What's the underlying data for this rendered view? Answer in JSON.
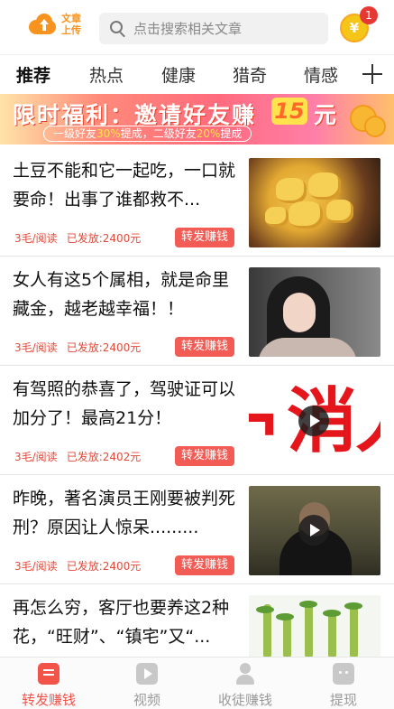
{
  "header": {
    "upload_label": "文章上传",
    "search_placeholder": "点击搜索相关文章",
    "coin_symbol": "¥",
    "notification_count": "1"
  },
  "tabs": [
    {
      "label": "推荐",
      "active": true
    },
    {
      "label": "热点"
    },
    {
      "label": "健康"
    },
    {
      "label": "猎奇"
    },
    {
      "label": "情感"
    }
  ],
  "banner": {
    "title": "限时福利：邀请好友赚",
    "amount": "15",
    "unit": "元",
    "sub_prefix": "一级好友",
    "sub_rate1": "30%",
    "sub_mid": "提成，二级好友",
    "sub_rate2": "20%",
    "sub_suffix": "提成"
  },
  "articles": [
    {
      "title": "土豆不能和它一起吃，一口就要命！出事了谁都救不...",
      "rate": "3毛/阅读",
      "paid": "已发放:2400元",
      "share": "转发赚钱",
      "thumb": "potato-dish",
      "video": false
    },
    {
      "title": "女人有这5个属相，就是命里藏金，越老越幸福！！",
      "rate": "3毛/阅读",
      "paid": "已发放:2400元",
      "share": "转发赚钱",
      "thumb": "woman-portrait",
      "video": false
    },
    {
      "title": "有驾照的恭喜了，驾驶证可以加分了！最高21分！",
      "rate": "3毛/阅读",
      "paid": "已发放:2402元",
      "share": "转发赚钱",
      "thumb": "red-characters",
      "thumb_text": "消",
      "video": true
    },
    {
      "title": "昨晚，著名演员王刚要被判死 刑？原因让人惊呆.........",
      "rate": "3毛/阅读",
      "paid": "已发放:2400元",
      "share": "转发赚钱",
      "thumb": "actor-still",
      "video": true
    },
    {
      "title": "再怎么穷，客厅也要养这2种花，“旺财”、“镇宅”又“...",
      "thumb": "bamboo-plants",
      "video": false
    }
  ],
  "bottom_nav": [
    {
      "label": "转发赚钱",
      "icon": "share-earn-icon",
      "active": true
    },
    {
      "label": "视频",
      "icon": "video-icon"
    },
    {
      "label": "收徒赚钱",
      "icon": "recruit-icon"
    },
    {
      "label": "提现",
      "icon": "withdraw-icon"
    }
  ],
  "colors": {
    "accent": "#f2544a",
    "meta_text": "#e24a3b",
    "upload_orange": "#f7931e"
  }
}
